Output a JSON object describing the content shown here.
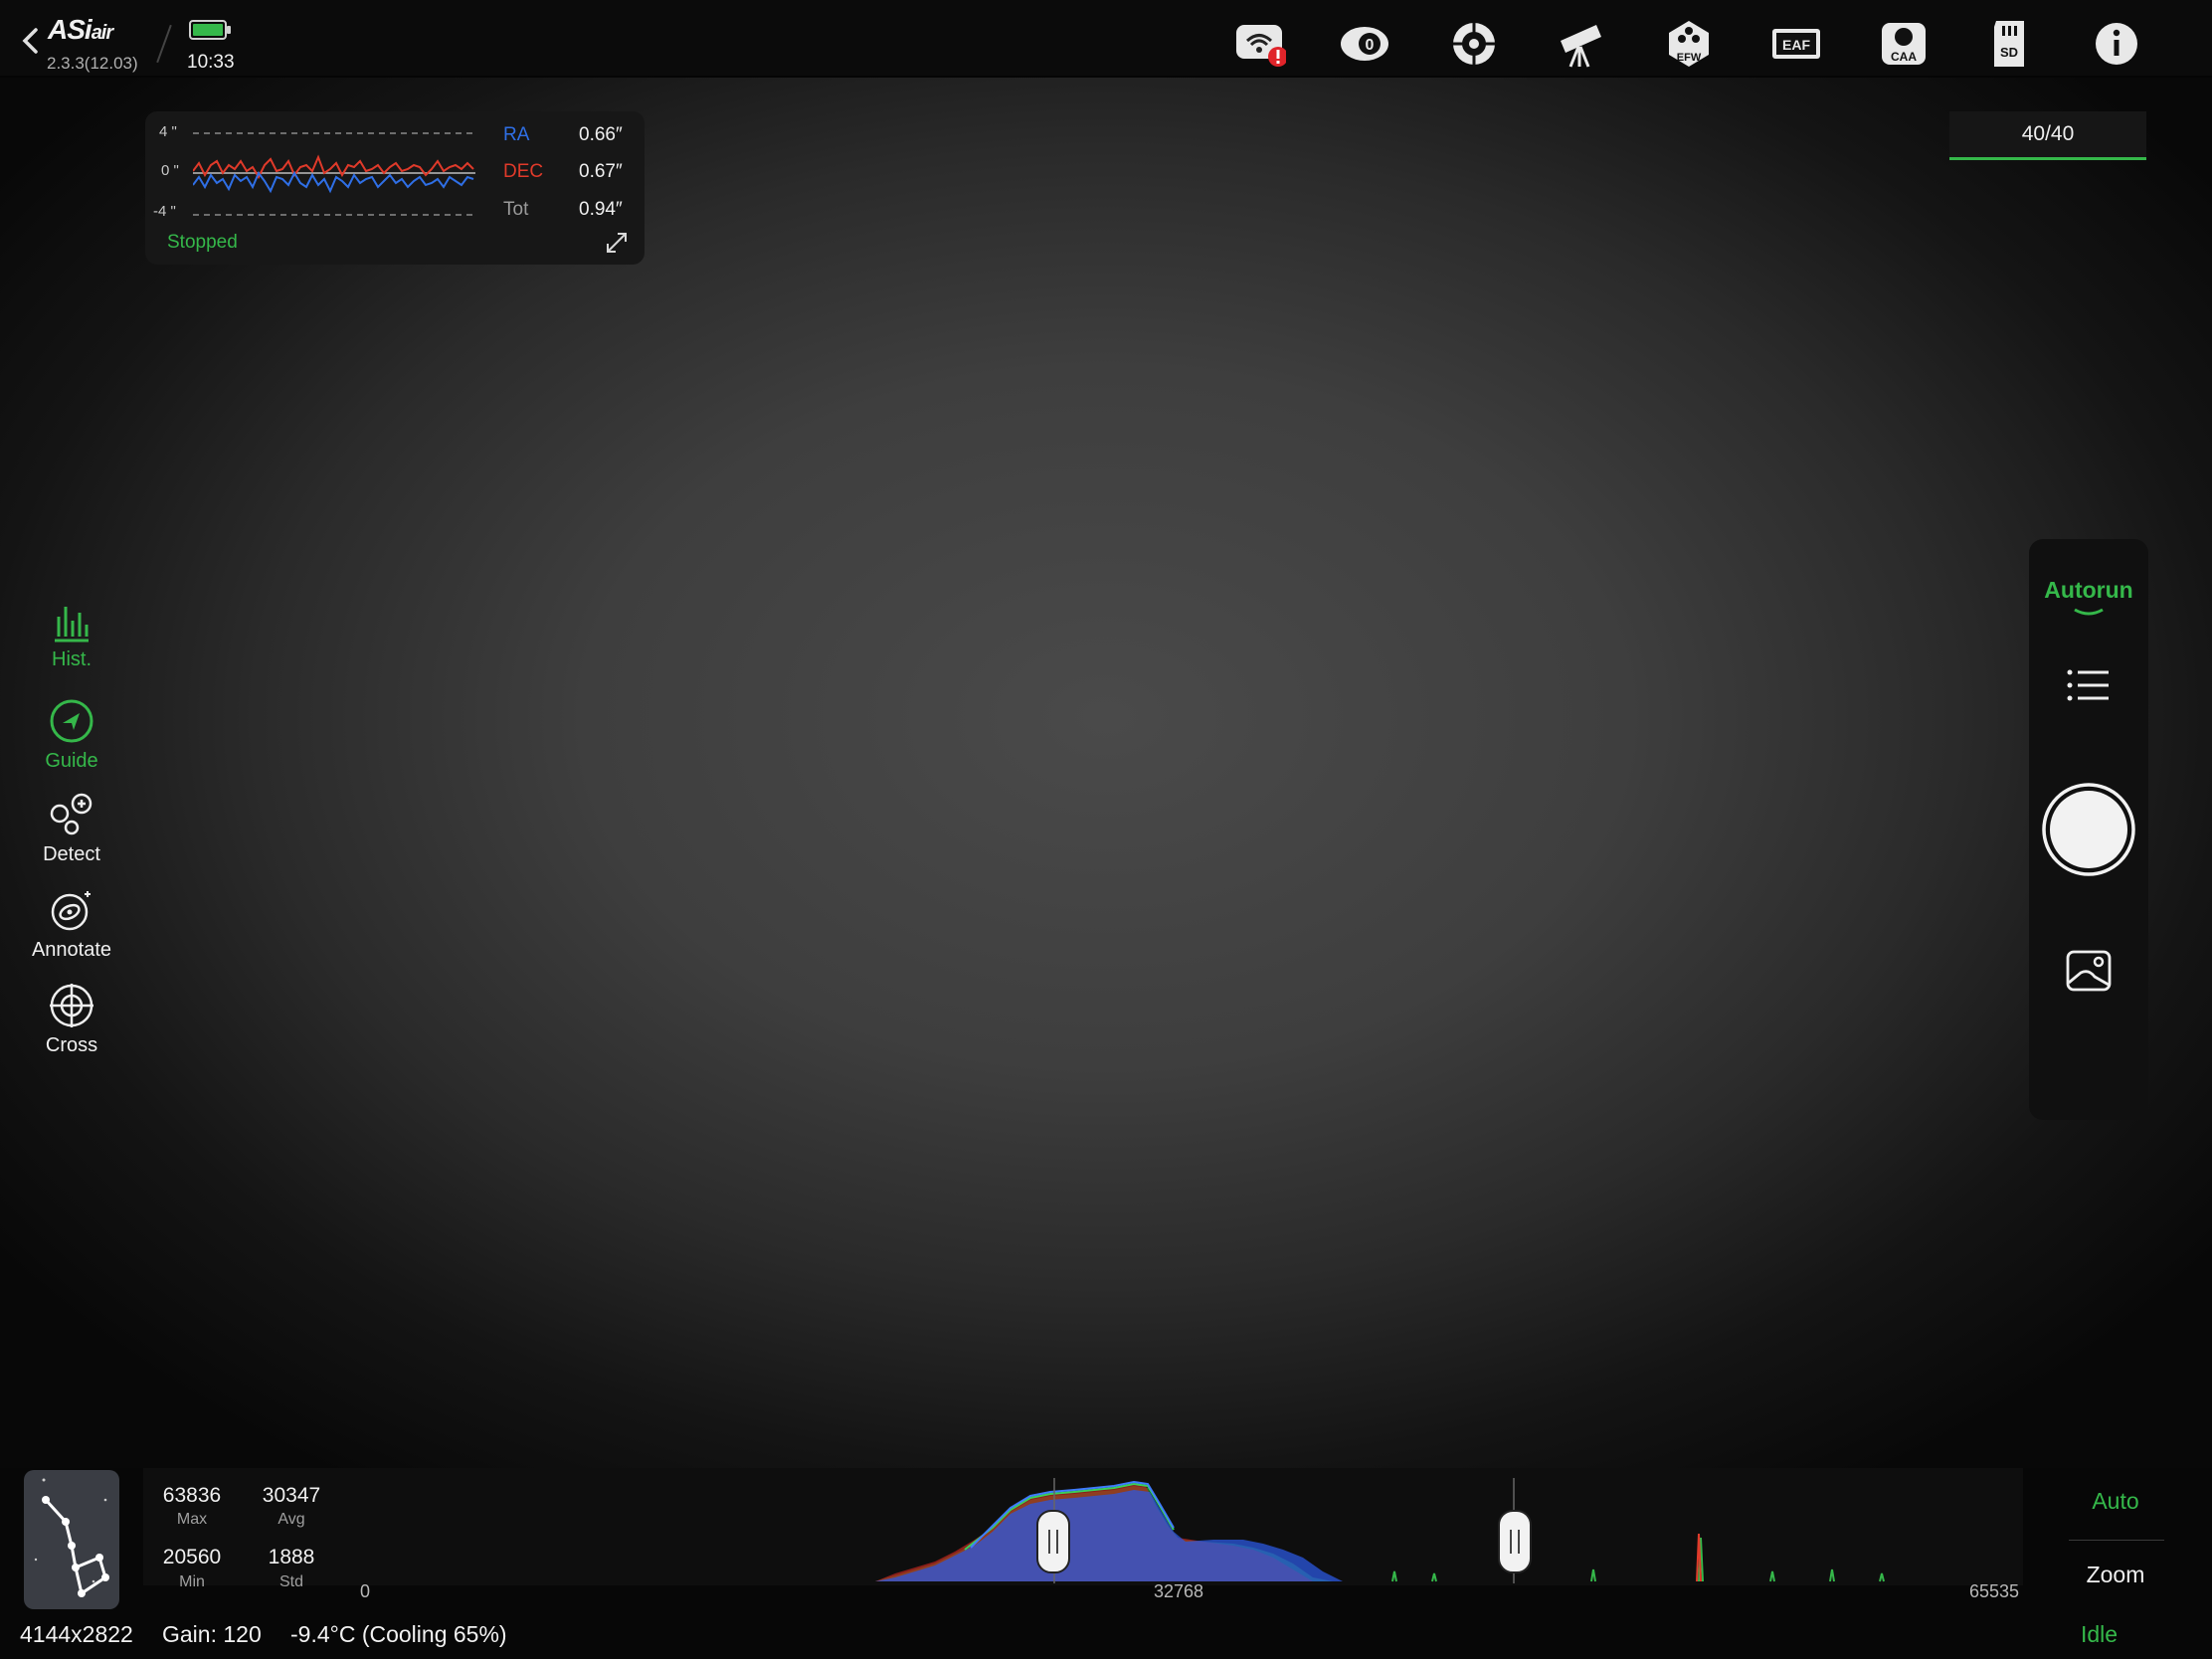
{
  "app": {
    "version": "2.3.3(12.03)",
    "time": "10:33"
  },
  "top_icons": [
    "wifi-alert-icon",
    "camera-icon",
    "guide-scope-icon",
    "telescope-icon",
    "efw-icon",
    "eaf-icon",
    "caa-icon",
    "sd-card-icon",
    "info-icon"
  ],
  "top_icon_labels": {
    "efw": "EFW",
    "eaf": "EAF",
    "caa": "CAA",
    "sd": "SD"
  },
  "guide": {
    "y_ticks": [
      "4 \"",
      "0 \"",
      "-4 \""
    ],
    "ra_label": "RA",
    "ra_value": "0.66″",
    "dec_label": "DEC",
    "dec_value": "0.67″",
    "tot_label": "Tot",
    "tot_value": "0.94″",
    "status": "Stopped",
    "colors": {
      "ra": "#2f6fe6",
      "dec": "#e03a2a",
      "status": "#35b84a"
    }
  },
  "counter": "40/40",
  "left_tools": [
    {
      "label": "Hist.",
      "active": true
    },
    {
      "label": "Guide",
      "active": true
    },
    {
      "label": "Detect",
      "active": false
    },
    {
      "label": "Annotate",
      "active": false
    },
    {
      "label": "Cross",
      "active": false
    }
  ],
  "right_panel": {
    "mode": "Autorun"
  },
  "stats": {
    "max": "63836",
    "max_label": "Max",
    "avg": "30347",
    "avg_label": "Avg",
    "min": "20560",
    "min_label": "Min",
    "std": "1888",
    "std_label": "Std"
  },
  "histogram_axis": [
    "0",
    "32768",
    "65535"
  ],
  "hist_buttons": {
    "auto": "Auto",
    "zoom": "Zoom"
  },
  "status_bar": {
    "resolution": "4144x2822",
    "gain": "Gain: 120",
    "temp": "-9.4°C (Cooling 65%)",
    "state": "Idle"
  },
  "accent": "#35b84a"
}
